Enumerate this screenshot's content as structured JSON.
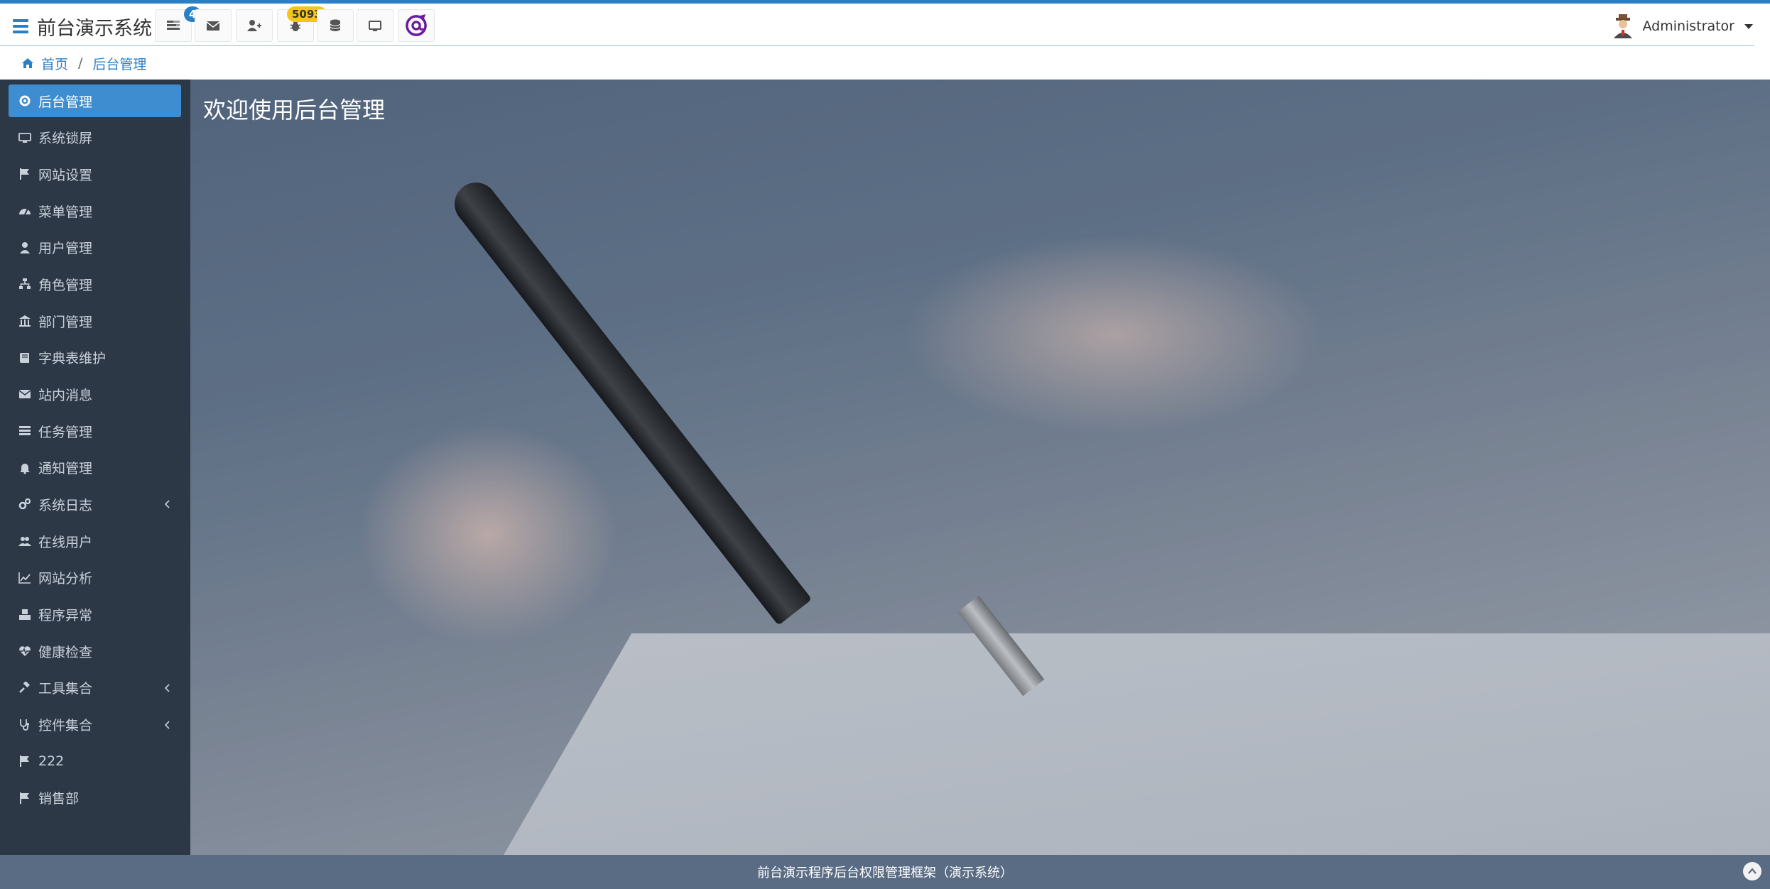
{
  "header": {
    "brand_title": "前台演示系统",
    "toolbar": [
      {
        "icon": "tasks-icon",
        "badge": "4"
      },
      {
        "icon": "envelope-icon"
      },
      {
        "icon": "user-plus-icon"
      },
      {
        "icon": "bug-icon",
        "badge": "5093"
      },
      {
        "icon": "database-icon"
      },
      {
        "icon": "monitor-icon"
      },
      {
        "icon": "at-logo-icon"
      }
    ],
    "user_name": "Administrator"
  },
  "breadcrumb": {
    "home": "首页",
    "separator": "/",
    "current": "后台管理"
  },
  "sidebar": {
    "items": [
      {
        "label": "后台管理",
        "icon": "gear-icon",
        "active": true
      },
      {
        "label": "系统锁屏",
        "icon": "monitor-icon"
      },
      {
        "label": "网站设置",
        "icon": "flag-icon"
      },
      {
        "label": "菜单管理",
        "icon": "dashboard-icon"
      },
      {
        "label": "用户管理",
        "icon": "user-icon"
      },
      {
        "label": "角色管理",
        "icon": "sitemap-icon"
      },
      {
        "label": "部门管理",
        "icon": "bank-icon"
      },
      {
        "label": "字典表维护",
        "icon": "book-icon"
      },
      {
        "label": "站内消息",
        "icon": "envelope-icon"
      },
      {
        "label": "任务管理",
        "icon": "tasks-icon"
      },
      {
        "label": "通知管理",
        "icon": "bell-icon"
      },
      {
        "label": "系统日志",
        "icon": "cogs-icon",
        "expandable": true
      },
      {
        "label": "在线用户",
        "icon": "users-icon"
      },
      {
        "label": "网站分析",
        "icon": "line-chart-icon"
      },
      {
        "label": "程序异常",
        "icon": "cubes-icon"
      },
      {
        "label": "健康检查",
        "icon": "heartbeat-icon"
      },
      {
        "label": "工具集合",
        "icon": "gavel-icon",
        "expandable": true
      },
      {
        "label": "控件集合",
        "icon": "stethoscope-icon",
        "expandable": true
      },
      {
        "label": "222",
        "icon": "flag-icon"
      },
      {
        "label": "销售部",
        "icon": "flag-icon"
      }
    ]
  },
  "main": {
    "welcome": "欢迎使用后台管理"
  },
  "footer": {
    "text": "前台演示程序后台权限管理框架（演示系统）"
  },
  "colors": {
    "accent": "#2b7fc3",
    "sidebar_bg": "#2c3846",
    "sidebar_active": "#3d8dd0",
    "footer_bg": "#596c84",
    "badge_blue": "#2b7fc3",
    "badge_yellow": "#f5c518"
  }
}
